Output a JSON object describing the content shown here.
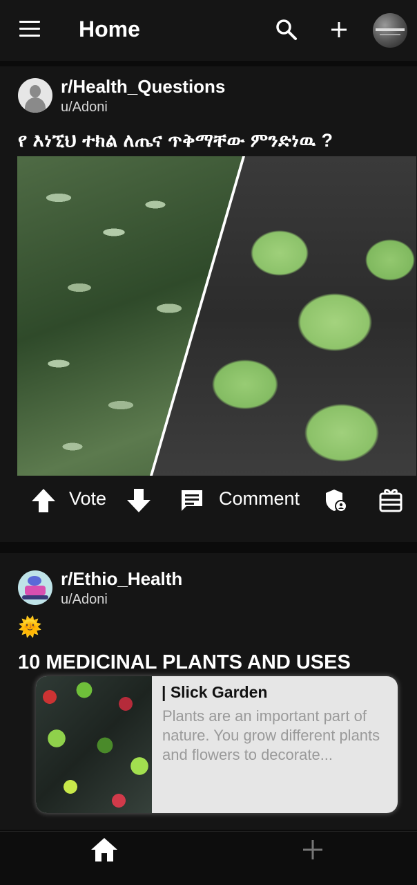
{
  "topbar": {
    "title": "Home",
    "icons": {
      "menu": "menu-icon",
      "search": "search-icon",
      "add": "plus-icon",
      "avatar": "avatar"
    }
  },
  "posts": [
    {
      "subreddit": "r/Health_Questions",
      "author": "u/Adoni",
      "title": "የ እነኚህ ተክል ለጤና ጥቅማቸው ምንድነዉ ?",
      "image": "two-plant-photos",
      "actions": {
        "vote_label": "Vote",
        "comment_label": "Comment"
      }
    },
    {
      "subreddit": "r/Ethio_Health",
      "author": "u/Adoni",
      "flair": "🌞",
      "title": "10 MEDICINAL PLANTS AND USES",
      "link": {
        "site": "| Slick Garden",
        "description": "Plants are an important part of nature. You grow different plants and flowers to decorate..."
      }
    }
  ],
  "bottom_nav": {
    "items": [
      "home",
      "create"
    ]
  },
  "colors": {
    "background": "#0b0b0b",
    "card": "#151515",
    "text": "#ffffff",
    "muted": "#d6d6d6",
    "link_card": "#e6e6e6"
  }
}
